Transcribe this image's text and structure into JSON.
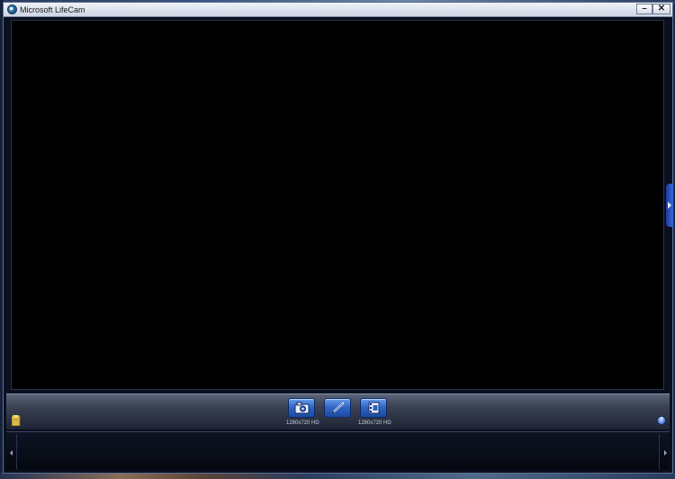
{
  "window": {
    "title": "Microsoft LifeCam",
    "minimize_label": "–",
    "close_label": "✕",
    "icon": "lifecam-icon"
  },
  "toolbar": {
    "photo_button_icon": "camera-icon",
    "edit_button_icon": "pencil-icon",
    "video_button_icon": "video-camera-icon",
    "photo_resolution": "1280x720 HD",
    "video_resolution": "1280x720 HD",
    "folder_icon": "folder-icon",
    "help_label": "?"
  },
  "filmstrip": {
    "scroll_left_icon": "chevron-left-icon",
    "scroll_right_icon": "chevron-right-icon"
  },
  "side_panel": {
    "toggle_icon": "chevron-right-icon"
  },
  "colors": {
    "accent": "#2e62c2",
    "viewport": "#000000"
  }
}
